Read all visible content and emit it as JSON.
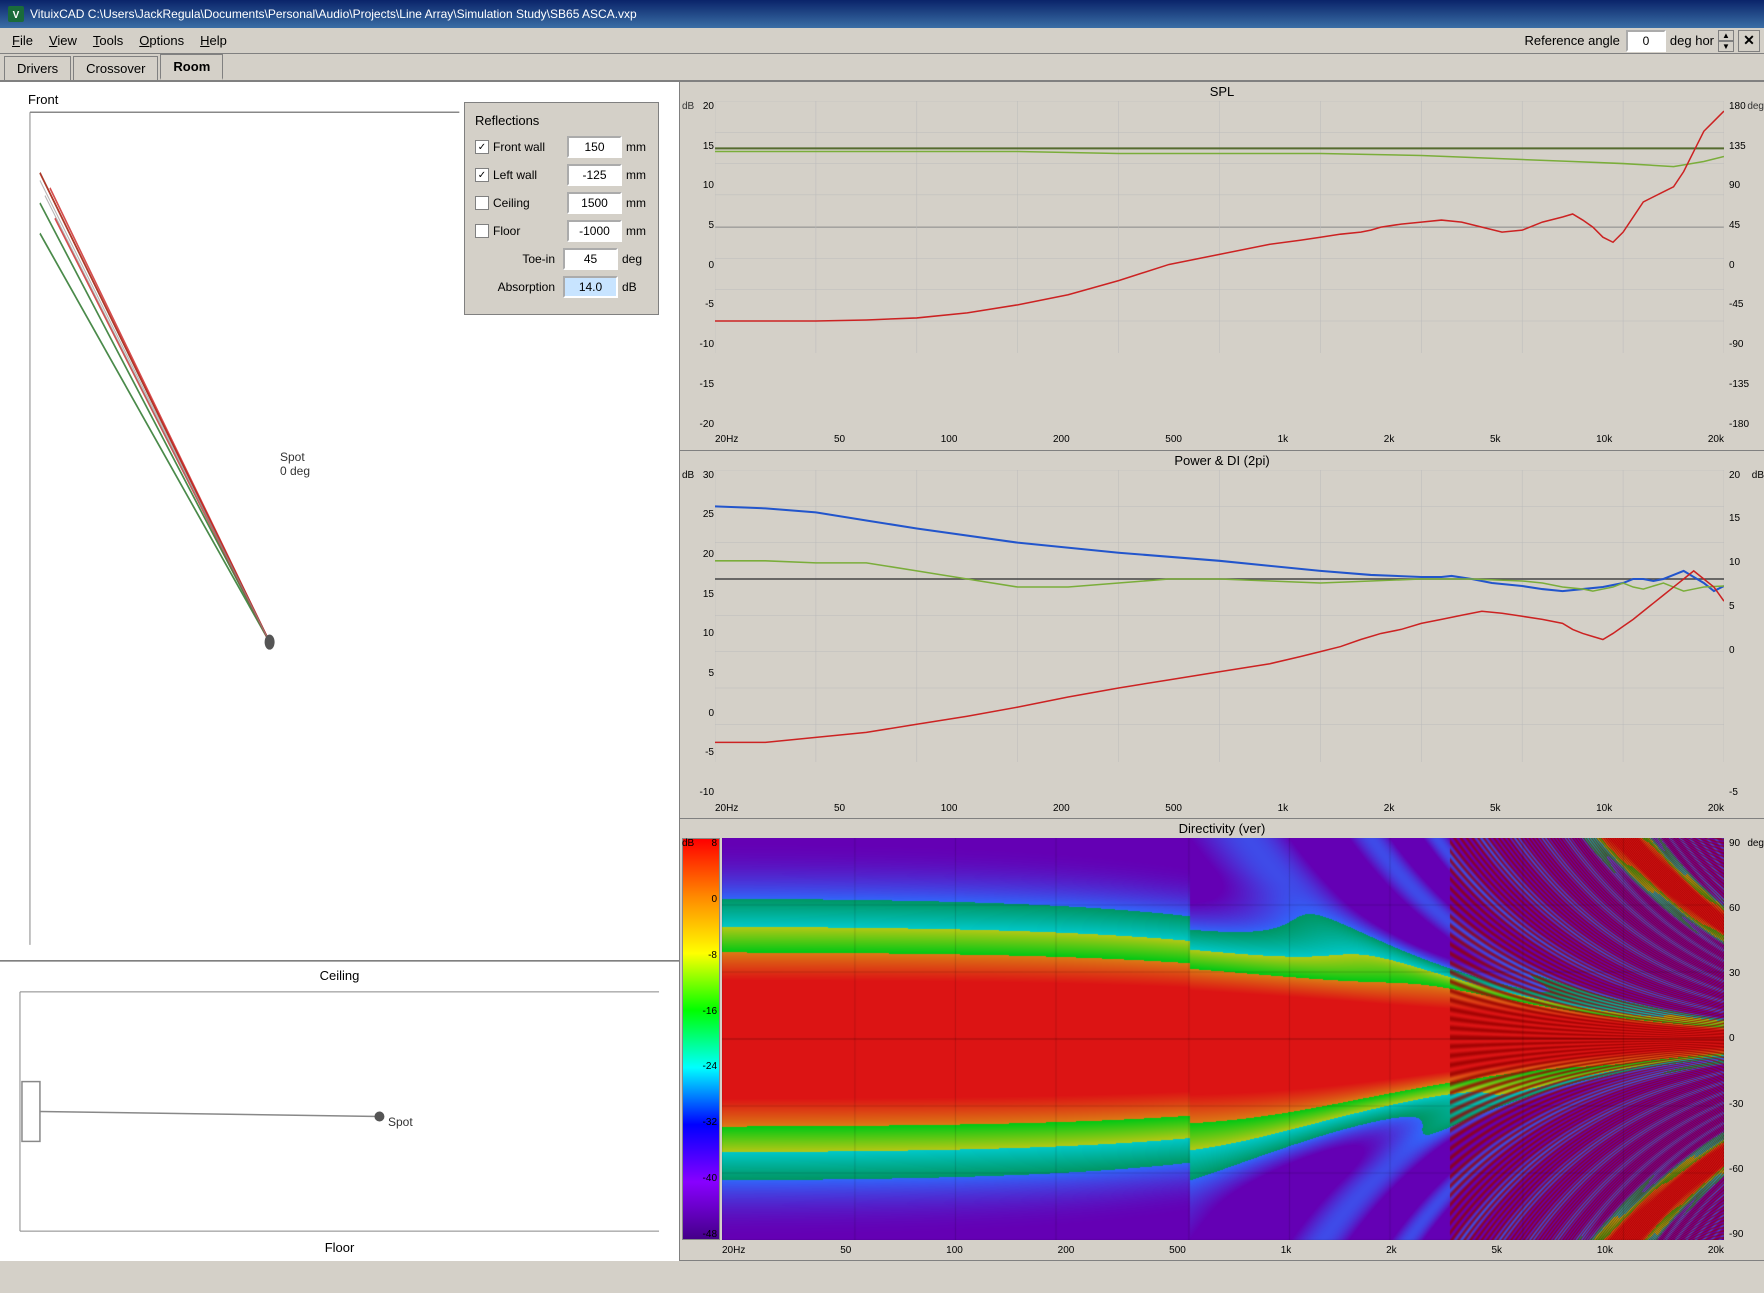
{
  "titlebar": {
    "title": "VituixCAD  C:\\Users\\JackRegula\\Documents\\Personal\\Audio\\Projects\\Line Array\\Simulation Study\\SB65 ASCA.vxp"
  },
  "menubar": {
    "items": [
      "File",
      "View",
      "Tools",
      "Options",
      "Help"
    ]
  },
  "toolbar": {
    "reference_angle_label": "Reference angle",
    "reference_angle_value": "0",
    "deg_hor_label": "deg hor"
  },
  "tabs": {
    "items": [
      "Drivers",
      "Crossover",
      "Room"
    ],
    "active": "Room"
  },
  "room": {
    "top_label": "Front",
    "spot_label": "Spot",
    "spot_angle": "0 deg",
    "ceiling_label": "Ceiling",
    "floor_label": "Floor"
  },
  "reflections": {
    "title": "Reflections",
    "front_wall": {
      "label": "Front wall",
      "checked": true,
      "value": "150",
      "unit": "mm"
    },
    "left_wall": {
      "label": "Left wall",
      "checked": true,
      "value": "-125",
      "unit": "mm"
    },
    "ceiling": {
      "label": "Ceiling",
      "checked": false,
      "value": "1500",
      "unit": "mm"
    },
    "floor": {
      "label": "Floor",
      "checked": false,
      "value": "-1000",
      "unit": "mm"
    },
    "toe_in": {
      "label": "Toe-in",
      "value": "45",
      "unit": "deg"
    },
    "absorption": {
      "label": "Absorption",
      "value": "14.0",
      "unit": "dB"
    }
  },
  "charts": {
    "spl": {
      "title": "SPL",
      "y_left": [
        "20",
        "15",
        "10",
        "5",
        "0",
        "-5",
        "-10",
        "-15",
        "-20"
      ],
      "y_left_unit": "dB",
      "y_right": [
        "180",
        "135",
        "90",
        "45",
        "0",
        "-45",
        "-90",
        "-135",
        "-180"
      ],
      "y_right_unit": "deg",
      "x_axis": [
        "20Hz",
        "50",
        "100",
        "200",
        "500",
        "1k",
        "2k",
        "5k",
        "10k",
        "20k"
      ]
    },
    "power_di": {
      "title": "Power & DI (2pi)",
      "y_left": [
        "30",
        "25",
        "20",
        "15",
        "10",
        "5",
        "0",
        "-5",
        "-10"
      ],
      "y_left_unit": "dB",
      "y_right": [
        "20",
        "15",
        "10",
        "5",
        "0",
        "-5"
      ],
      "y_right_unit": "dB",
      "x_axis": [
        "20Hz",
        "50",
        "100",
        "200",
        "500",
        "1k",
        "2k",
        "5k",
        "10k",
        "20k"
      ]
    },
    "directivity": {
      "title": "Directivity (ver)",
      "colorbar_labels": [
        "8",
        "0",
        "-8",
        "-16",
        "-24",
        "-32",
        "-40",
        "-48"
      ],
      "colorbar_unit": "dB",
      "y_right": [
        "90",
        "60",
        "30",
        "0",
        "-30",
        "-60",
        "-90"
      ],
      "y_right_unit": "deg",
      "x_axis": [
        "20Hz",
        "50",
        "100",
        "200",
        "500",
        "1k",
        "2k",
        "5k",
        "10k",
        "20k"
      ]
    }
  }
}
